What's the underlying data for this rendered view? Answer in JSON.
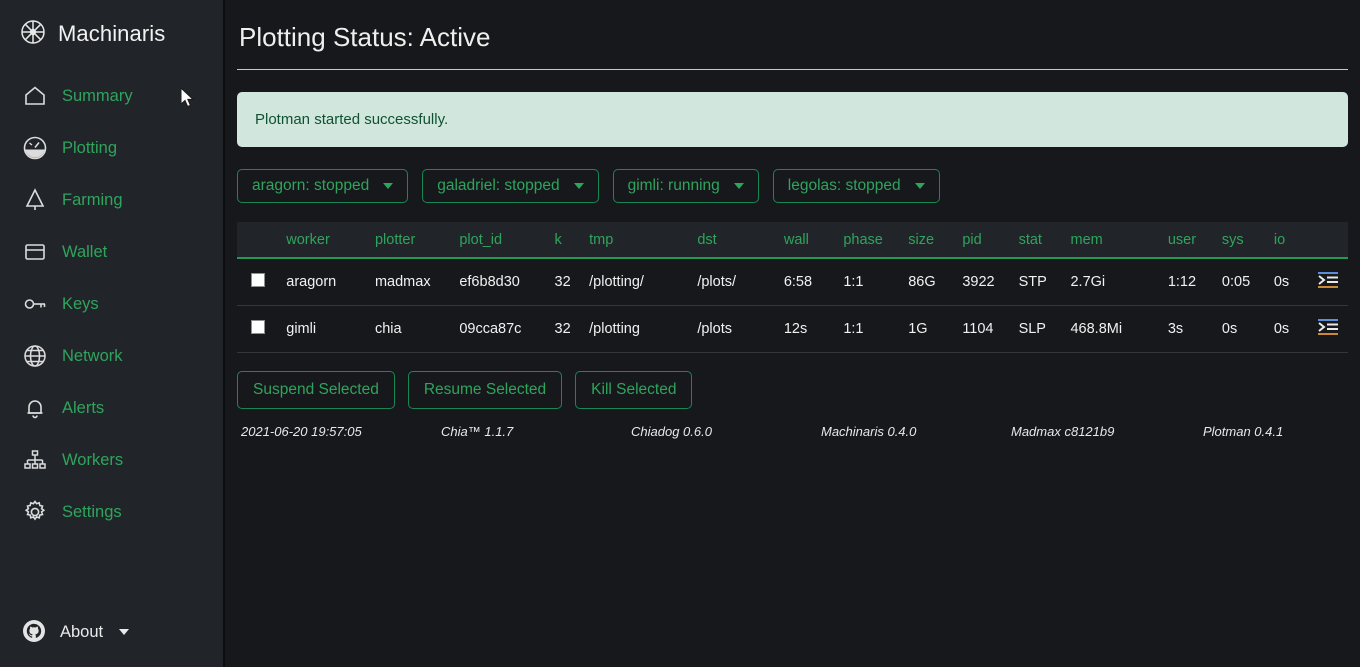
{
  "brand": {
    "title": "Machinaris",
    "logo_icon": "flower-wheel-logo-icon"
  },
  "sidebar": {
    "items": [
      {
        "label": "Summary",
        "icon": "home-icon"
      },
      {
        "label": "Plotting",
        "icon": "speedometer-icon"
      },
      {
        "label": "Farming",
        "icon": "tree-icon"
      },
      {
        "label": "Wallet",
        "icon": "wallet-icon"
      },
      {
        "label": "Keys",
        "icon": "key-icon"
      },
      {
        "label": "Network",
        "icon": "globe-icon"
      },
      {
        "label": "Alerts",
        "icon": "bell-icon"
      },
      {
        "label": "Workers",
        "icon": "sitemap-icon"
      },
      {
        "label": "Settings",
        "icon": "gear-icon"
      }
    ],
    "about": {
      "label": "About",
      "icon": "github-icon"
    }
  },
  "header": {
    "title": "Plotting Status: Active"
  },
  "alert": {
    "message": "Plotman started successfully."
  },
  "worker_buttons": [
    {
      "label": "aragorn: stopped"
    },
    {
      "label": "galadriel: stopped"
    },
    {
      "label": "gimli: running"
    },
    {
      "label": "legolas: stopped"
    }
  ],
  "table": {
    "columns": [
      "",
      "worker",
      "plotter",
      "plot_id",
      "k",
      "tmp",
      "dst",
      "wall",
      "phase",
      "size",
      "pid",
      "stat",
      "mem",
      "user",
      "sys",
      "io",
      ""
    ],
    "rows": [
      {
        "worker": "aragorn",
        "plotter": "madmax",
        "plot_id": "ef6b8d30",
        "k": "32",
        "tmp": "/plotting/",
        "dst": "/plots/",
        "wall": "6:58",
        "phase": "1:1",
        "size": "86G",
        "pid": "3922",
        "stat": "STP",
        "mem": "2.7Gi",
        "user": "1:12",
        "sys": "0:05",
        "io": "0s",
        "log_icon": "console-log-icon"
      },
      {
        "worker": "gimli",
        "plotter": "chia",
        "plot_id": "09cca87c",
        "k": "32",
        "tmp": "/plotting",
        "dst": "/plots",
        "wall": "12s",
        "phase": "1:1",
        "size": "1G",
        "pid": "1104",
        "stat": "SLP",
        "mem": "468.8Mi",
        "user": "3s",
        "sys": "0s",
        "io": "0s",
        "log_icon": "console-log-icon"
      }
    ]
  },
  "actions": [
    {
      "label": "Suspend Selected"
    },
    {
      "label": "Resume Selected"
    },
    {
      "label": "Kill Selected"
    }
  ],
  "footer": {
    "timestamp": "2021-06-20 19:57:05",
    "chia": "Chia™ 1.1.7",
    "chiadog": "Chiadog 0.6.0",
    "machinaris": "Machinaris 0.4.0",
    "madmax": "Madmax c8121b9",
    "plotman": "Plotman 0.4.1"
  },
  "colors": {
    "accent_green": "#2fa45c",
    "border_green": "#198754",
    "sidebar_bg": "#212529",
    "main_bg": "#16181c",
    "alert_bg": "#d1e7dd",
    "alert_text": "#0f5132"
  }
}
